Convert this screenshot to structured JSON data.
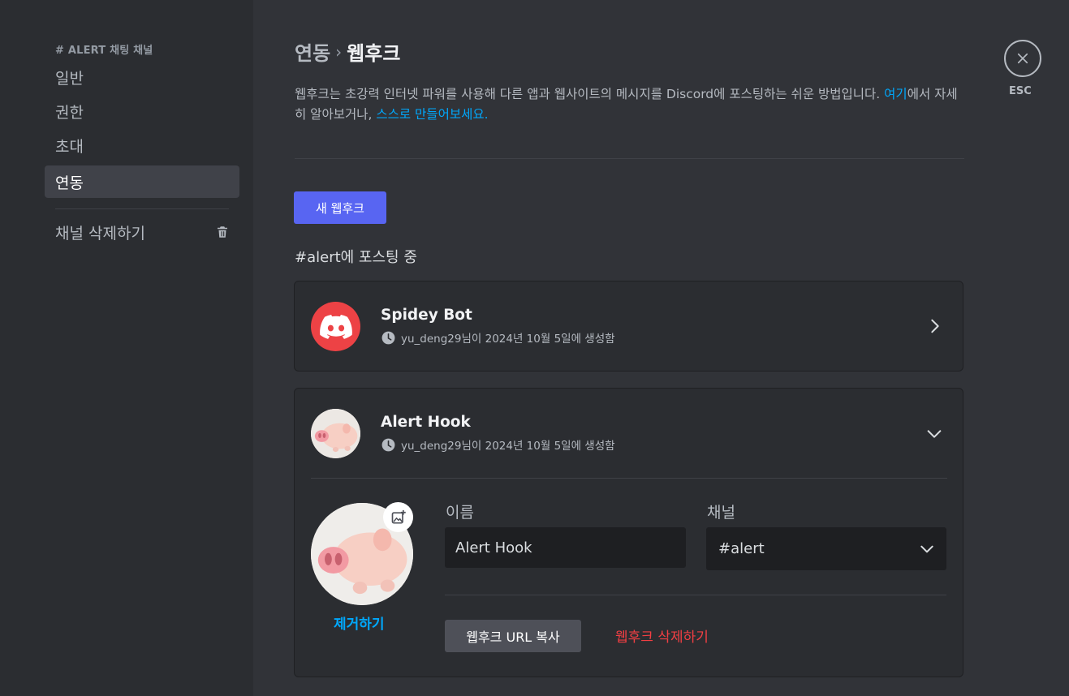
{
  "sidebar": {
    "header": "# ALERT 채팅 채널",
    "items": [
      {
        "label": "일반"
      },
      {
        "label": "권한"
      },
      {
        "label": "초대"
      },
      {
        "label": "연동"
      }
    ],
    "delete_label": "채널 삭제하기"
  },
  "header": {
    "breadcrumb_parent": "연동",
    "breadcrumb_separator": "›",
    "title": "웹후크",
    "description_prefix": "웹후크는 초강력 인터넷 파워를 사용해 다른 앱과 웹사이트의 메시지를 Discord에 포스팅하는 쉬운 방법입니다. ",
    "link_here": "여기",
    "description_mid": "에서 자세히 알아보거나, ",
    "link_create": "스스로 만들어보세요."
  },
  "new_webhook_label": "새 웹후크",
  "posting_label": "#alert에 포스팅 중",
  "webhooks": [
    {
      "name": "Spidey Bot",
      "meta": "yu_deng29님이 2024년 10월 5일에 생성함",
      "avatar_icon": "discord-logo-icon",
      "accent": "#ed4245"
    },
    {
      "name": "Alert Hook",
      "meta": "yu_deng29님이 2024년 10월 5일에 생성함",
      "avatar_icon": "pig-avatar"
    }
  ],
  "editor": {
    "remove_avatar_label": "제거하기",
    "name_label": "이름",
    "name_value": "Alert Hook",
    "channel_label": "채널",
    "channel_value": "#alert",
    "copy_url_label": "웹후크 URL 복사",
    "delete_label": "웹후크 삭제하기"
  },
  "close": {
    "label": "ESC"
  },
  "colors": {
    "brand": "#5865f2",
    "link": "#00a8fc",
    "danger": "#f23f43"
  }
}
